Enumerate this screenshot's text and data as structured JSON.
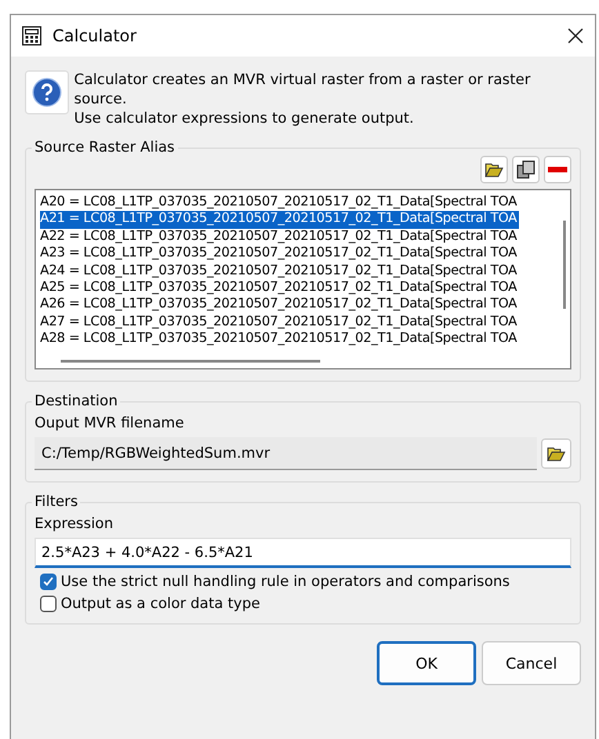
{
  "window": {
    "title": "Calculator"
  },
  "description": "Calculator creates an MVR virtual raster from a raster or raster source.\nUse calculator expressions to generate output.",
  "source_raster": {
    "title": "Source Raster Alias",
    "items": [
      {
        "label": "A20 = LC08_L1TP_037035_20210507_20210517_02_T1_Data[Spectral TOA",
        "selected": false
      },
      {
        "label": "A21 = LC08_L1TP_037035_20210507_20210517_02_T1_Data[Spectral TOA",
        "selected": true
      },
      {
        "label": "A22 = LC08_L1TP_037035_20210507_20210517_02_T1_Data[Spectral TOA",
        "selected": false
      },
      {
        "label": "A23 = LC08_L1TP_037035_20210507_20210517_02_T1_Data[Spectral TOA",
        "selected": false
      },
      {
        "label": "A24 = LC08_L1TP_037035_20210507_20210517_02_T1_Data[Spectral TOA",
        "selected": false
      },
      {
        "label": "A25 = LC08_L1TP_037035_20210507_20210517_02_T1_Data[Spectral TOA",
        "selected": false
      },
      {
        "label": "A26 = LC08_L1TP_037035_20210507_20210517_02_T1_Data[Spectral TOA",
        "selected": false
      },
      {
        "label": "A27 = LC08_L1TP_037035_20210507_20210517_02_T1_Data[Spectral TOA",
        "selected": false
      },
      {
        "label": "A28 = LC08_L1TP_037035_20210507_20210517_02_T1_Data[Spectral TOA",
        "selected": false
      }
    ]
  },
  "destination": {
    "title": "Destination",
    "label": "Ouput MVR filename",
    "value": "C:/Temp/RGBWeightedSum.mvr"
  },
  "filters": {
    "title": "Filters",
    "label": "Expression",
    "value": "2.5*A23 + 4.0*A22 - 6.5*A21",
    "options": [
      {
        "label": "Use the strict null handling rule in operators and comparisons",
        "checked": true
      },
      {
        "label": "Output as a color data type",
        "checked": false
      }
    ]
  },
  "buttons": [
    {
      "label": "OK",
      "kind": "primary"
    },
    {
      "label": "Cancel",
      "kind": "normal"
    }
  ]
}
